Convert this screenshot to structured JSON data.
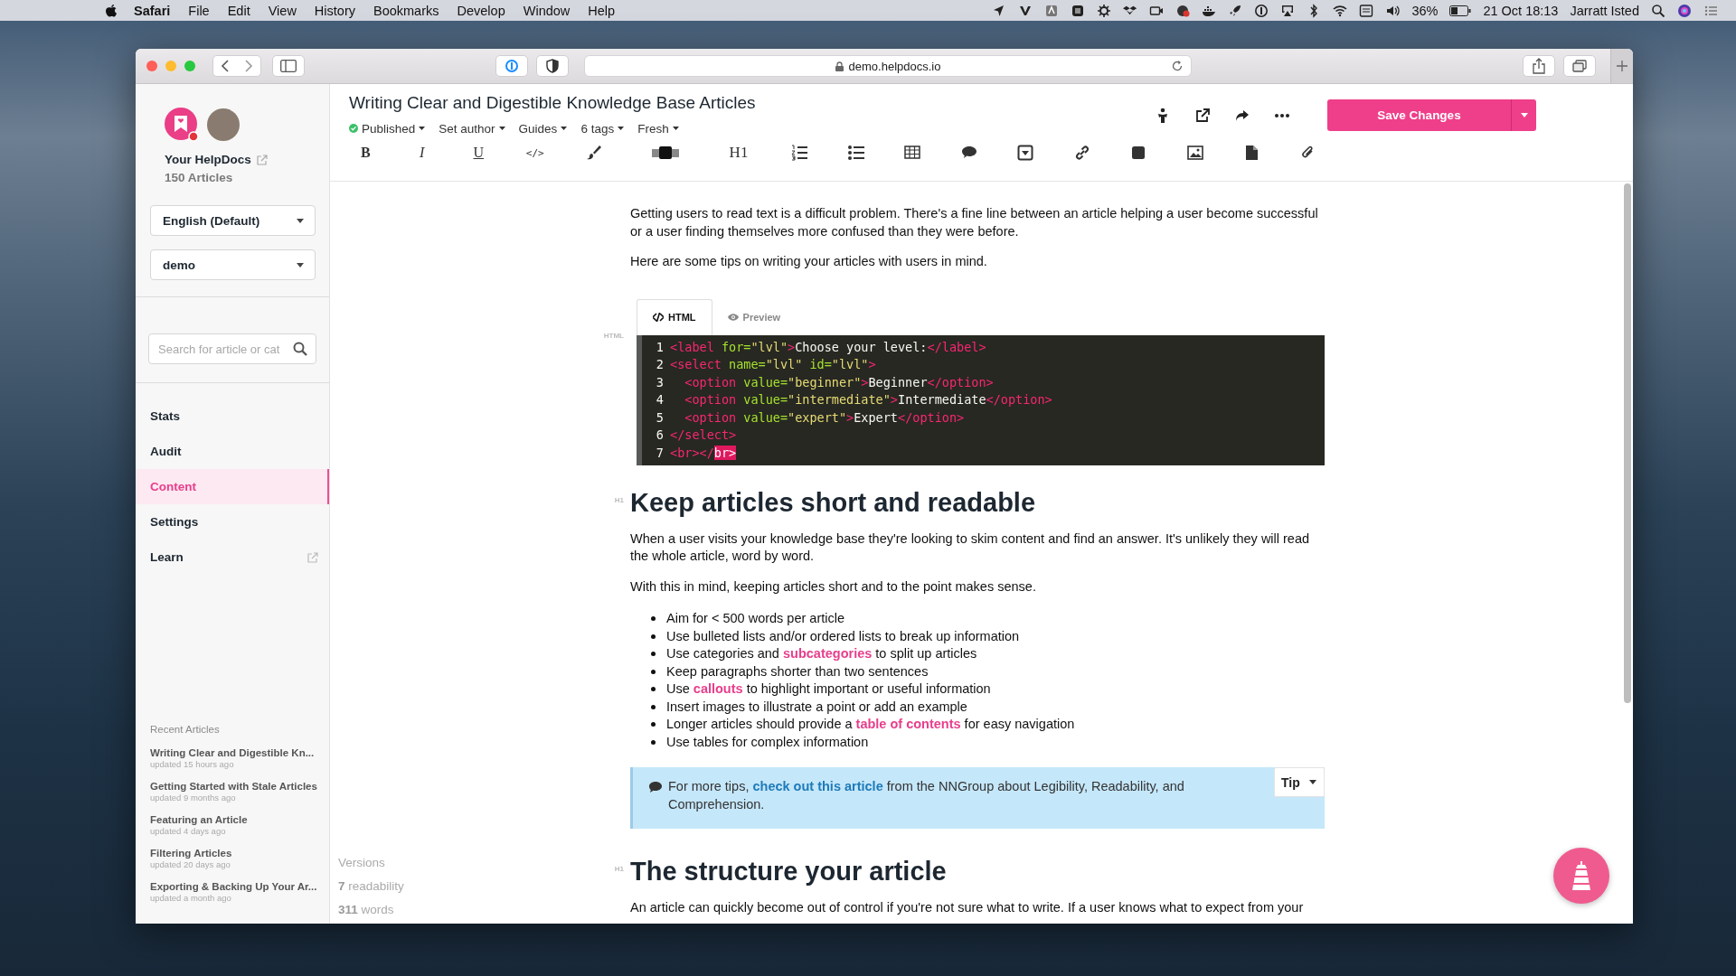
{
  "menubar": {
    "app": "Safari",
    "menus": [
      "File",
      "Edit",
      "View",
      "History",
      "Bookmarks",
      "Develop",
      "Window",
      "Help"
    ],
    "battery": "36%",
    "clock": "21 Oct 18:13",
    "user": "Jarratt Isted"
  },
  "browser": {
    "url": "demo.helpdocs.io"
  },
  "sidebar": {
    "site_name": "Your HelpDocs",
    "article_count": "150 Articles",
    "language": "English (Default)",
    "workspace": "demo",
    "search": {
      "placeholder": "Search for article or cat"
    },
    "nav": [
      {
        "label": "Stats",
        "selected": false,
        "external": false
      },
      {
        "label": "Audit",
        "selected": false,
        "external": false
      },
      {
        "label": "Content",
        "selected": true,
        "external": false
      },
      {
        "label": "Settings",
        "selected": false,
        "external": false
      },
      {
        "label": "Learn",
        "selected": false,
        "external": true
      }
    ],
    "recent_heading": "Recent Articles",
    "recent": [
      {
        "title": "Writing Clear and Digestible Kn...",
        "updated": "updated 15 hours ago"
      },
      {
        "title": "Getting Started with Stale Articles",
        "updated": "updated 9 months ago"
      },
      {
        "title": "Featuring an Article",
        "updated": "updated 4 days ago"
      },
      {
        "title": "Filtering Articles",
        "updated": "updated 20 days ago"
      },
      {
        "title": "Exporting & Backing Up Your Ar...",
        "updated": "updated a month ago"
      }
    ]
  },
  "article": {
    "title": "Writing Clear and Digestible Knowledge Base Articles",
    "status": "Published",
    "menus": [
      "Set author",
      "Guides",
      "6 tags",
      "Fresh"
    ],
    "save_button": "Save Changes",
    "toolbar_labels": [
      "B",
      "I",
      "U",
      "</>",
      "H1"
    ]
  },
  "editor": {
    "blocks": [
      {
        "kind": "paragraph",
        "text": "Getting users to read text is a difficult problem. There's a fine line between an article helping a user become successful or a user finding themselves more confused than they were before."
      },
      {
        "kind": "paragraph",
        "text": "Here are some tips on writing your articles with users in mind."
      },
      {
        "kind": "code",
        "gutter": "HTML",
        "tabs": [
          {
            "label": "HTML",
            "selected": true
          },
          {
            "label": "Preview",
            "selected": false
          }
        ],
        "lines": [
          {
            "number": "1",
            "tokens": [
              {
                "text": "<label",
                "kind": "tag"
              },
              {
                "text": " for=",
                "kind": "attr"
              },
              {
                "text": "\"lvl\"",
                "kind": "string"
              },
              {
                "text": ">",
                "kind": "tag"
              },
              {
                "text": "Choose your level:",
                "kind": "text"
              },
              {
                "text": "</label>",
                "kind": "tag"
              }
            ]
          },
          {
            "number": "2",
            "tokens": [
              {
                "text": "<select",
                "kind": "tag"
              },
              {
                "text": " name=",
                "kind": "attr"
              },
              {
                "text": "\"lvl\"",
                "kind": "string"
              },
              {
                "text": " id=",
                "kind": "attr"
              },
              {
                "text": "\"lvl\"",
                "kind": "string"
              },
              {
                "text": ">",
                "kind": "tag"
              }
            ]
          },
          {
            "number": "3",
            "tokens": [
              {
                "text": "  <option",
                "kind": "tag"
              },
              {
                "text": " value=",
                "kind": "attr"
              },
              {
                "text": "\"beginner\"",
                "kind": "string"
              },
              {
                "text": ">",
                "kind": "tag"
              },
              {
                "text": "Beginner",
                "kind": "text"
              },
              {
                "text": "</option>",
                "kind": "tag"
              }
            ]
          },
          {
            "number": "4",
            "tokens": [
              {
                "text": "  <option",
                "kind": "tag"
              },
              {
                "text": " value=",
                "kind": "attr"
              },
              {
                "text": "\"intermediate\"",
                "kind": "string"
              },
              {
                "text": ">",
                "kind": "tag"
              },
              {
                "text": "Intermediate",
                "kind": "text"
              },
              {
                "text": "</option>",
                "kind": "tag"
              }
            ]
          },
          {
            "number": "5",
            "tokens": [
              {
                "text": "  <option",
                "kind": "tag"
              },
              {
                "text": " value=",
                "kind": "attr"
              },
              {
                "text": "\"expert\"",
                "kind": "string"
              },
              {
                "text": ">",
                "kind": "tag"
              },
              {
                "text": "Expert",
                "kind": "text"
              },
              {
                "text": "</option>",
                "kind": "tag"
              }
            ]
          },
          {
            "number": "6",
            "tokens": [
              {
                "text": "</select>",
                "kind": "tag"
              }
            ]
          },
          {
            "number": "7",
            "tokens": [
              {
                "text": "<br></",
                "kind": "tag"
              },
              {
                "text": "br>",
                "kind": "selection"
              }
            ]
          }
        ]
      },
      {
        "kind": "heading",
        "gutter": "H1",
        "text": "Keep articles short and readable"
      },
      {
        "kind": "paragraph",
        "text": "When a user visits your knowledge base they're looking to skim content and find an answer. It's unlikely they will read the whole article, word by word."
      },
      {
        "kind": "paragraph",
        "text": "With this in mind, keeping articles short and to the point makes sense."
      },
      {
        "kind": "list",
        "items": [
          [
            {
              "text": "Aim for < 500 words per article",
              "kind": "text"
            }
          ],
          [
            {
              "text": "Use bulleted lists and/or ordered lists to break up information",
              "kind": "text"
            }
          ],
          [
            {
              "text": "Use categories and ",
              "kind": "text"
            },
            {
              "text": "subcategories",
              "kind": "link"
            },
            {
              "text": " to split up articles",
              "kind": "text"
            }
          ],
          [
            {
              "text": "Keep paragraphs shorter than two sentences",
              "kind": "text"
            }
          ],
          [
            {
              "text": "Use ",
              "kind": "text"
            },
            {
              "text": "callouts",
              "kind": "link"
            },
            {
              "text": " to highlight important or useful information",
              "kind": "text"
            }
          ],
          [
            {
              "text": "Insert images to illustrate a point or add an example",
              "kind": "text"
            }
          ],
          [
            {
              "text": "Longer articles should provide a ",
              "kind": "text"
            },
            {
              "text": "table of contents",
              "kind": "link"
            },
            {
              "text": " for easy navigation",
              "kind": "text"
            }
          ],
          [
            {
              "text": "Use tables for complex information",
              "kind": "text"
            }
          ]
        ]
      },
      {
        "kind": "callout",
        "type_label": "Tip",
        "segments": [
          {
            "text": "For more tips, ",
            "kind": "text"
          },
          {
            "text": "check out this article",
            "kind": "link"
          },
          {
            "text": " from the NNGroup about Legibility, Readability, and Comprehension.",
            "kind": "text"
          }
        ]
      },
      {
        "kind": "heading",
        "gutter": "H1",
        "text": "The structure your article"
      },
      {
        "kind": "paragraph",
        "text": "An article can quickly become out of control if you're not sure what to write. If a user knows what to expect from your"
      }
    ]
  },
  "stats": {
    "versions": "Versions",
    "readability": "**7** readability",
    "words": "**311** words"
  }
}
